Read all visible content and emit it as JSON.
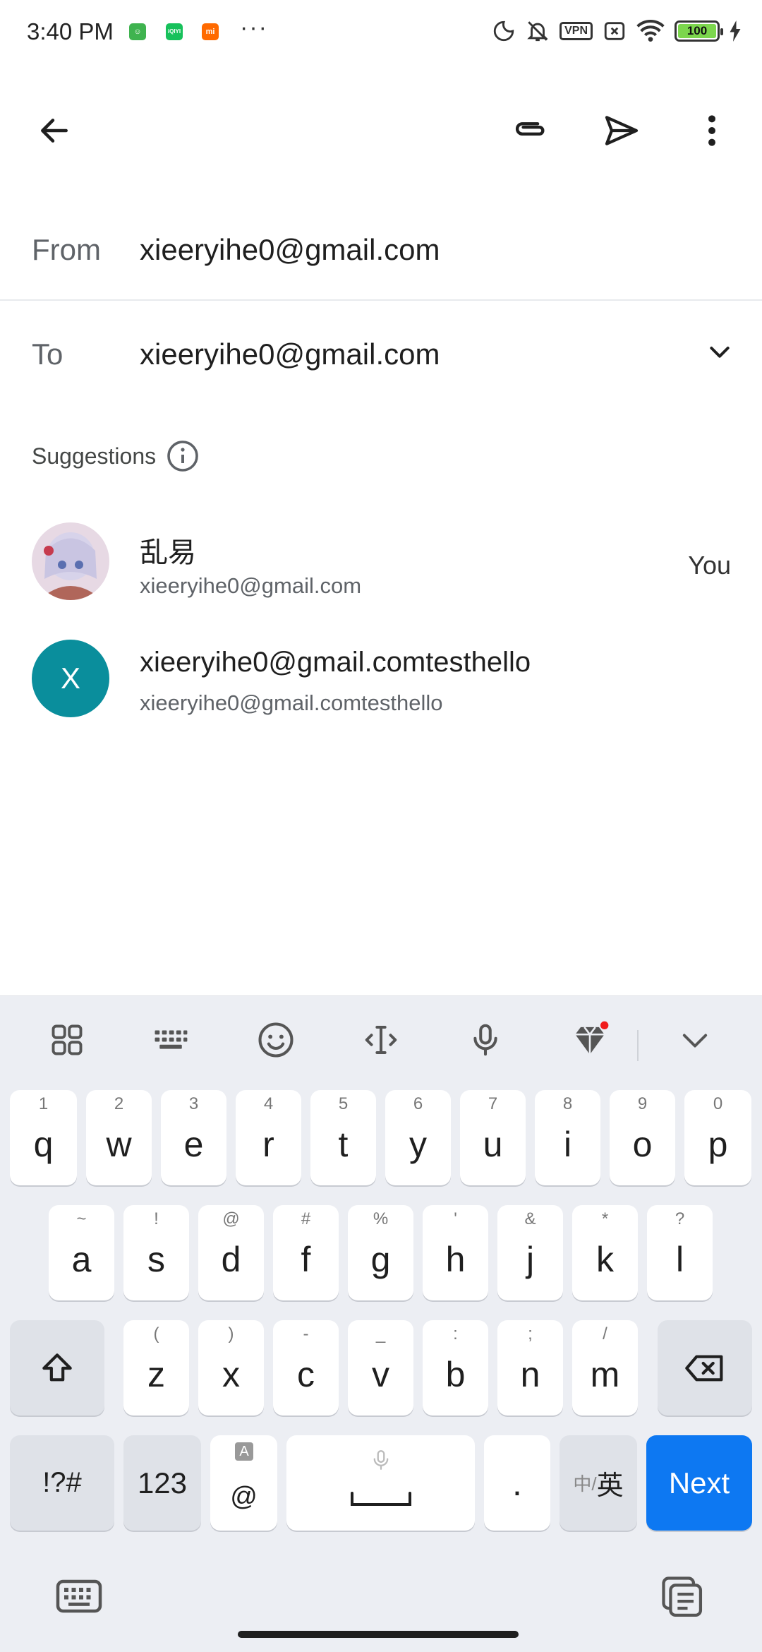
{
  "status_bar": {
    "time": "3:40 PM",
    "app_icons": [
      "android-app-icon",
      "iqiyi-icon",
      "xiaomi-icon"
    ],
    "app_colors": [
      "#3fb34f",
      "#17c15b",
      "#ff6a00"
    ],
    "more": "···",
    "vpn": "VPN",
    "battery": "100",
    "battery_color": "#7cd64d"
  },
  "compose": {
    "from_label": "From",
    "from_value": "xieeryihe0@gmail.com",
    "to_label": "To",
    "to_value": "xieeryihe0@gmail.com"
  },
  "suggestions": {
    "title": "Suggestions",
    "contacts": [
      {
        "name": "乱易",
        "email": "xieeryihe0@gmail.com",
        "tag": "You"
      },
      {
        "initial": "X",
        "name": "xieeryihe0@gmail.comtesthello",
        "email": "xieeryihe0@gmail.comtesthello",
        "avatar_color": "#0a8e9c"
      }
    ]
  },
  "keyboard": {
    "row1": [
      {
        "k": "q",
        "h": "1"
      },
      {
        "k": "w",
        "h": "2"
      },
      {
        "k": "e",
        "h": "3"
      },
      {
        "k": "r",
        "h": "4"
      },
      {
        "k": "t",
        "h": "5"
      },
      {
        "k": "y",
        "h": "6"
      },
      {
        "k": "u",
        "h": "7"
      },
      {
        "k": "i",
        "h": "8"
      },
      {
        "k": "o",
        "h": "9"
      },
      {
        "k": "p",
        "h": "0"
      }
    ],
    "row2": [
      {
        "k": "a",
        "h": "~"
      },
      {
        "k": "s",
        "h": "!"
      },
      {
        "k": "d",
        "h": "@"
      },
      {
        "k": "f",
        "h": "#"
      },
      {
        "k": "g",
        "h": "%"
      },
      {
        "k": "h",
        "h": "'"
      },
      {
        "k": "j",
        "h": "&"
      },
      {
        "k": "k",
        "h": "*"
      },
      {
        "k": "l",
        "h": "?"
      }
    ],
    "row3": [
      {
        "k": "z",
        "h": "("
      },
      {
        "k": "x",
        "h": ")"
      },
      {
        "k": "c",
        "h": "-"
      },
      {
        "k": "v",
        "h": "_"
      },
      {
        "k": "b",
        "h": ":"
      },
      {
        "k": "n",
        "h": ";"
      },
      {
        "k": "m",
        "h": "/"
      }
    ],
    "symbols_label": "!?#",
    "numbers_label": "123",
    "at_label": "@",
    "at_hint": "A",
    "period_label": ".",
    "lang_label_small": "中/",
    "lang_label_main": "英",
    "next_label": "Next",
    "accent_color": "#0d78f2"
  }
}
